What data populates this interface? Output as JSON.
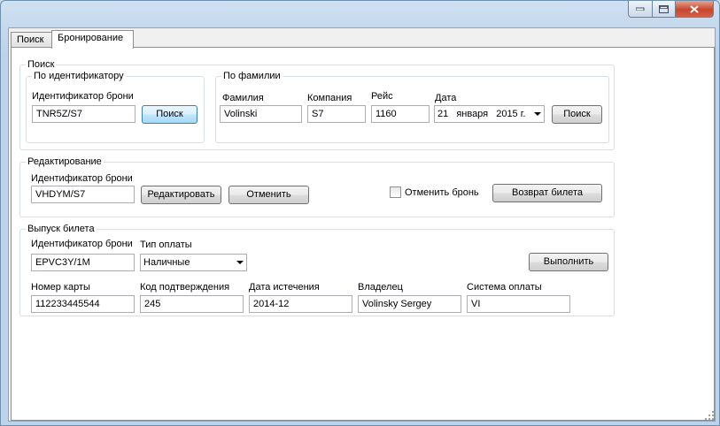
{
  "tabs": [
    {
      "label": "Поиск"
    },
    {
      "label": "Бронирование"
    }
  ],
  "search": {
    "title": "Поиск",
    "by_id": {
      "title": "По идентификатору",
      "label": "Идентификатор брони",
      "value": "TNR5Z/S7",
      "button": "Поиск"
    },
    "by_name": {
      "title": "По фамилии",
      "surname_label": "Фамилия",
      "surname_value": "Volinski",
      "company_label": "Компания",
      "company_value": "S7",
      "flight_label": "Рейс",
      "flight_value": "1160",
      "date_label": "Дата",
      "date_day": "21",
      "date_month": "января",
      "date_year": "2015 г.",
      "button": "Поиск"
    }
  },
  "edit": {
    "title": "Редактирование",
    "label": "Идентификатор брони",
    "value": "VHDYM/S7",
    "edit_button": "Редактировать",
    "cancel_button": "Отменить",
    "cancel_booking_label": "Отменить бронь",
    "refund_button": "Возврат билета"
  },
  "issue": {
    "title": "Выпуск билета",
    "id_label": "Идентификатор брони",
    "id_value": "EPVC3Y/1M",
    "payment_type_label": "Тип оплаты",
    "payment_type_value": "Наличные",
    "execute_button": "Выполнить",
    "card_label": "Номер карты",
    "card_value": "112233445544",
    "code_label": "Код подтверждения",
    "code_value": "245",
    "expiry_label": "Дата истечения",
    "expiry_value": "2014-12",
    "owner_label": "Владелец",
    "owner_value": "Volinsky Sergey",
    "system_label": "Система оплаты",
    "system_value": "VI"
  }
}
